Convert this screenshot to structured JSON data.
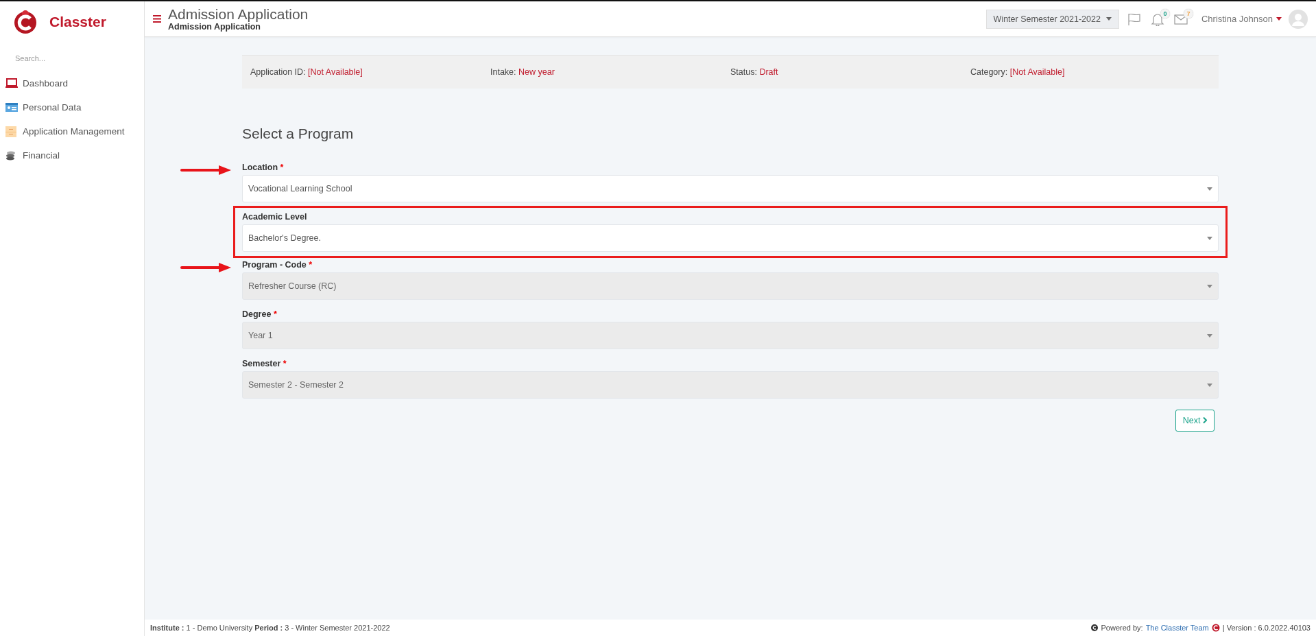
{
  "brand": {
    "name": "Classter"
  },
  "sidebar": {
    "search": {
      "placeholder": "Search..."
    },
    "items": [
      {
        "label": "Dashboard"
      },
      {
        "label": "Personal Data"
      },
      {
        "label": "Application Management"
      },
      {
        "label": "Financial"
      }
    ]
  },
  "header": {
    "title": "Admission Application",
    "subtitle": "Admission Application",
    "period": "Winter Semester 2021-2022",
    "notifications": [
      {
        "kind": "bell",
        "count": "0",
        "color": "#1aa38a"
      },
      {
        "kind": "mail",
        "count": "7",
        "color": "#f0a040"
      }
    ],
    "user": "Christina Johnson"
  },
  "info_bar": [
    {
      "label": "Application ID:",
      "value": "[Not Available]"
    },
    {
      "label": "Intake:",
      "value": "New year"
    },
    {
      "label": "Status:",
      "value": "Draft"
    },
    {
      "label": "Category:",
      "value": "[Not Available]"
    }
  ],
  "form": {
    "title": "Select a Program",
    "fields": [
      {
        "label": "Location",
        "required_mark": "*",
        "value": "Vocational Learning School",
        "disabled": false,
        "arrow": true,
        "highlighted": false
      },
      {
        "label": "Academic Level",
        "value": "Bachelor's Degree.",
        "disabled": false,
        "arrow": false,
        "highlighted": true
      },
      {
        "label": "Program - Code",
        "required_mark": "*",
        "value": "Refresher Course (RC)",
        "disabled": true,
        "arrow": true,
        "highlighted": false
      },
      {
        "label": "Degree",
        "required_mark": "*",
        "value": "Year 1",
        "disabled": true,
        "arrow": false,
        "highlighted": false
      },
      {
        "label": "Semester",
        "required_mark": "*",
        "value": "Semester 2 - Semester 2",
        "disabled": true,
        "arrow": false,
        "highlighted": false
      }
    ],
    "next_button": "Next"
  },
  "footer": {
    "context": "**Institute :** 1 - Demo University **Period :** 3 - Winter Semester 2021-2022",
    "powered_by": "Powered by:",
    "team_link": "The Classter Team",
    "version": "| Version : 6.0.2022.40103"
  }
}
